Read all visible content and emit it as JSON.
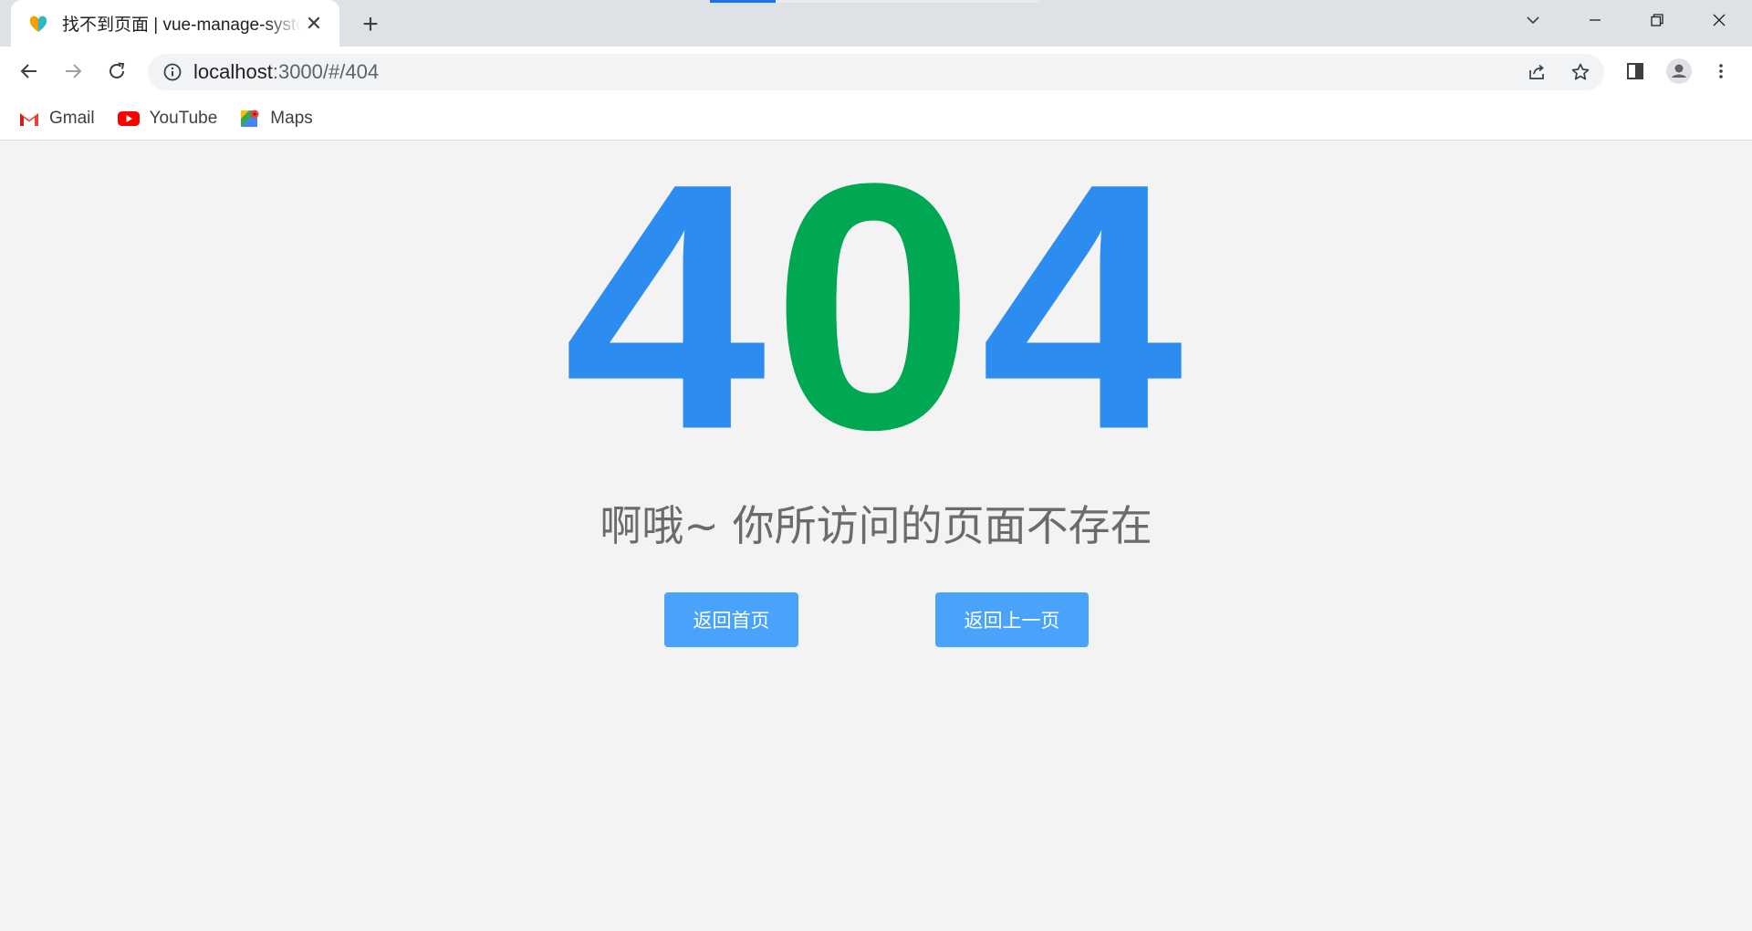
{
  "browser": {
    "tab": {
      "title": "找不到页面 | vue-manage-system",
      "close_glyph": "✕"
    },
    "new_tab_glyph": "+",
    "address": {
      "host": "localhost",
      "path": ":3000/#/404"
    },
    "bookmarks": [
      {
        "label": "Gmail",
        "icon": "gmail-icon"
      },
      {
        "label": "YouTube",
        "icon": "youtube-icon"
      },
      {
        "label": "Maps",
        "icon": "maps-icon"
      }
    ]
  },
  "page": {
    "error_code_digits": [
      "4",
      "0",
      "4"
    ],
    "message": "啊哦~ 你所访问的页面不存在",
    "buttons": {
      "home": "返回首页",
      "back": "返回上一页"
    }
  },
  "colors": {
    "digit_blue": "#2d8cf0",
    "digit_green": "#00a854",
    "button": "#4aa3fb",
    "background": "#f3f3f3"
  }
}
